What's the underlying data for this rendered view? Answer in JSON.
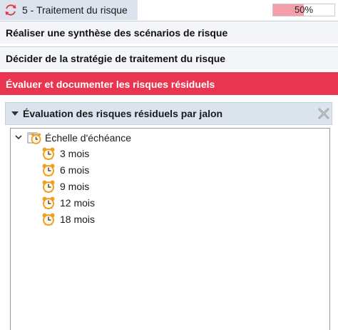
{
  "header": {
    "title": "5 - Traitement du risque",
    "progress_text": "50%",
    "progress_value": 0.5,
    "icon": "refresh-cycle-icon"
  },
  "steps": [
    {
      "label": "Réaliser une synthèse des scénarios de risque",
      "active": false
    },
    {
      "label": "Décider de la stratégie de traitement du risque",
      "active": false
    },
    {
      "label": "Évaluer et documenter les risques résiduels",
      "active": true
    }
  ],
  "panel": {
    "title": "Évaluation des risques résiduels par jalon",
    "close_icon": "close-x-icon"
  },
  "tree": {
    "root": {
      "label": "Échelle d'échéance",
      "icon": "alarm-clock-calendar-icon",
      "expanded": true
    },
    "items": [
      {
        "label": "3 mois",
        "icon": "alarm-clock-icon"
      },
      {
        "label": "6 mois",
        "icon": "alarm-clock-icon"
      },
      {
        "label": "9 mois",
        "icon": "alarm-clock-icon"
      },
      {
        "label": "12 mois",
        "icon": "alarm-clock-icon"
      },
      {
        "label": "18 mois",
        "icon": "alarm-clock-icon"
      }
    ]
  },
  "colors": {
    "accent_red": "#e93550",
    "progress_fill": "#f3a0ac",
    "header_bg": "#dce3ec",
    "alarm_orange": "#f0a020"
  }
}
